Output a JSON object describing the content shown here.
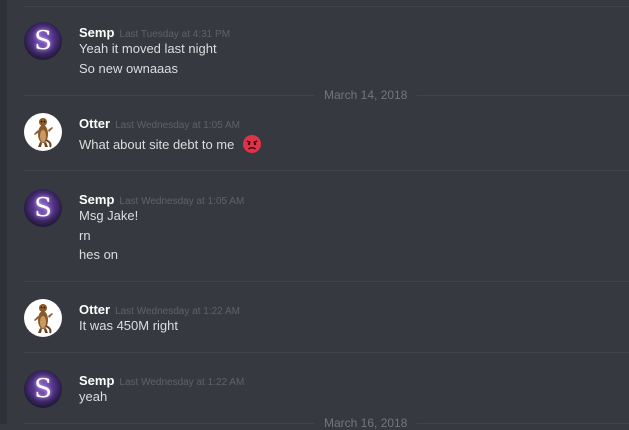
{
  "date_separators": [
    "March 14, 2018",
    "March 16, 2018"
  ],
  "messages": [
    {
      "username": "Semp",
      "timestamp": "Last Tuesday at 4:31 PM",
      "lines": [
        "Yeah it moved last night",
        "So new ownaaas"
      ]
    },
    {
      "username": "Otter",
      "timestamp": "Last Wednesday at 1:05 AM",
      "lines": [
        "What about site debt to me"
      ],
      "emoji": "angry-face-emoji"
    },
    {
      "username": "Semp",
      "timestamp": "Last Wednesday at 1:05 AM",
      "lines": [
        "Msg Jake!",
        "rn",
        "hes on"
      ]
    },
    {
      "username": "Otter",
      "timestamp": "Last Wednesday at 1:22 AM",
      "lines": [
        "It was 450M right"
      ]
    },
    {
      "username": "Semp",
      "timestamp": "Last Wednesday at 1:22 AM",
      "lines": [
        "yeah"
      ]
    }
  ],
  "colors": {
    "background": "#36393f",
    "username": "#ffffff",
    "message_text": "#dcddde",
    "timestamp": "#5f6269",
    "emoji_red": "#e0334a"
  },
  "avatars": {
    "semp": "letter-s-avatar-purple",
    "otter": "otter-cartoon-avatar"
  }
}
